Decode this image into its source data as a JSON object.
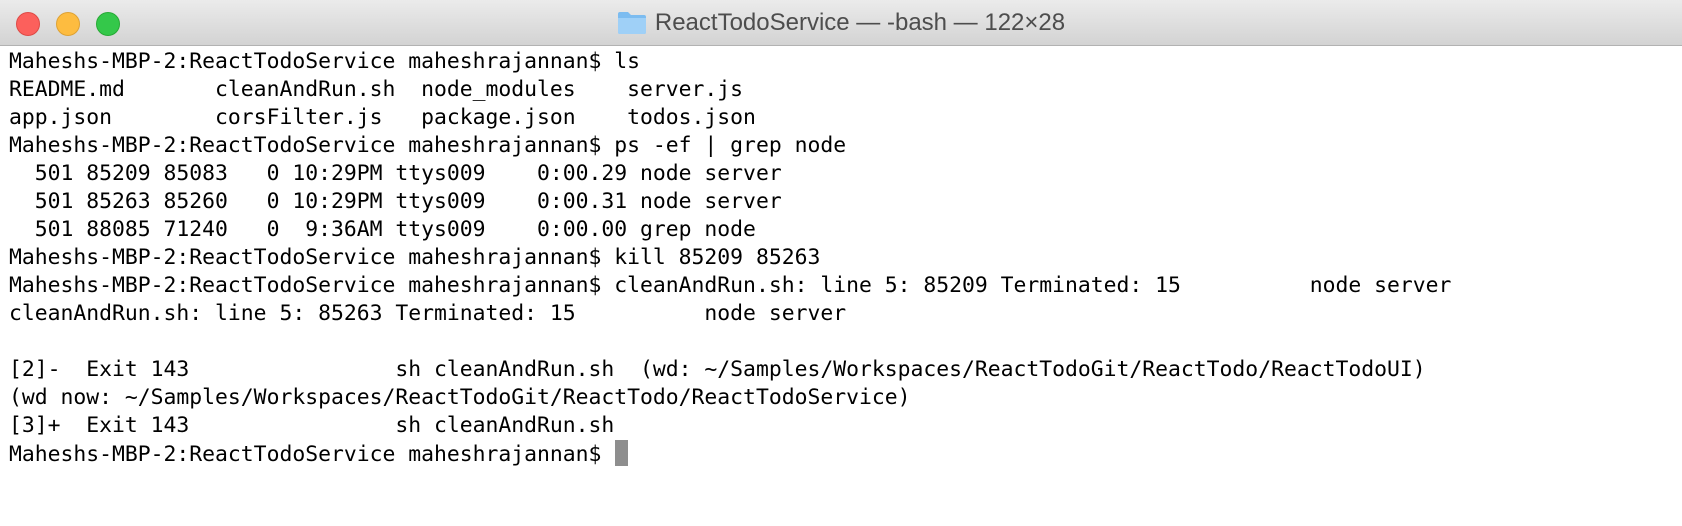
{
  "window": {
    "title": "ReactTodoService — -bash — 122×28",
    "folder_icon": "folder-icon",
    "accent_colors": {
      "close": "#fc605c",
      "minimize": "#fdbc40",
      "maximize": "#34c84a",
      "folder": "#7cbcf0"
    }
  },
  "terminal": {
    "lines": [
      "Maheshs-MBP-2:ReactTodoService maheshrajannan$ ls",
      "README.md       cleanAndRun.sh  node_modules    server.js",
      "app.json        corsFilter.js   package.json    todos.json",
      "Maheshs-MBP-2:ReactTodoService maheshrajannan$ ps -ef | grep node",
      "  501 85209 85083   0 10:29PM ttys009    0:00.29 node server",
      "  501 85263 85260   0 10:29PM ttys009    0:00.31 node server",
      "  501 88085 71240   0  9:36AM ttys009    0:00.00 grep node",
      "Maheshs-MBP-2:ReactTodoService maheshrajannan$ kill 85209 85263",
      "Maheshs-MBP-2:ReactTodoService maheshrajannan$ cleanAndRun.sh: line 5: 85209 Terminated: 15          node server",
      "cleanAndRun.sh: line 5: 85263 Terminated: 15          node server",
      "",
      "[2]-  Exit 143                sh cleanAndRun.sh  (wd: ~/Samples/Workspaces/ReactTodoGit/ReactTodo/ReactTodoUI)",
      "(wd now: ~/Samples/Workspaces/ReactTodoGit/ReactTodo/ReactTodoService)",
      "[3]+  Exit 143                sh cleanAndRun.sh"
    ],
    "prompt": "Maheshs-MBP-2:ReactTodoService maheshrajannan$ "
  }
}
